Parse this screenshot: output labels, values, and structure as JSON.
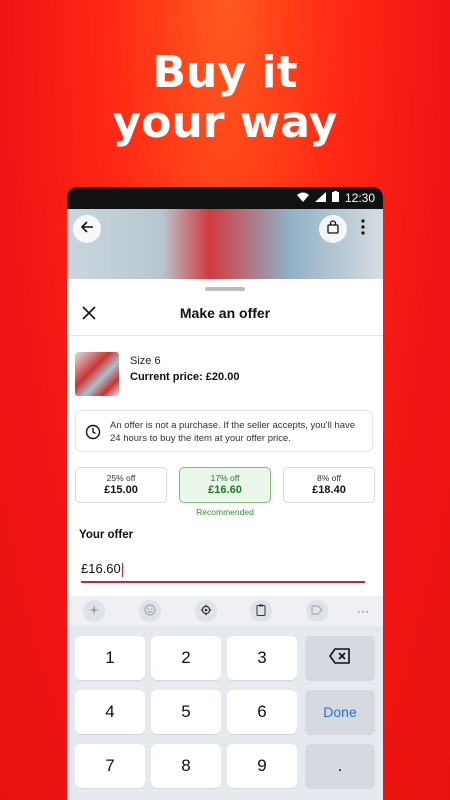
{
  "headline": {
    "line1": "Buy it",
    "line2": "your way"
  },
  "status": {
    "time": "12:30"
  },
  "sheet": {
    "title": "Make an offer"
  },
  "item": {
    "size": "Size 6",
    "current_price": "Current price: £20.00"
  },
  "info": {
    "text": "An offer is not a purchase. If the seller accepts, you'll have 24 hours to buy the item at your offer price."
  },
  "offers": [
    {
      "pct": "25% off",
      "amt": "£15.00"
    },
    {
      "pct": "17% off",
      "amt": "£16.60",
      "selected": true
    },
    {
      "pct": "8% off",
      "amt": "£18.40"
    }
  ],
  "recommended": "Recommended",
  "your_offer": {
    "label": "Your offer",
    "value": "£16.60"
  },
  "keyboard": {
    "keys": [
      "1",
      "2",
      "3",
      "4",
      "5",
      "6",
      "7",
      "8",
      "9"
    ],
    "done": "Done",
    "dot": ".",
    "more": "···"
  },
  "colors": {
    "accent": "#e8130f",
    "selected_green": "#1f7a1f"
  }
}
